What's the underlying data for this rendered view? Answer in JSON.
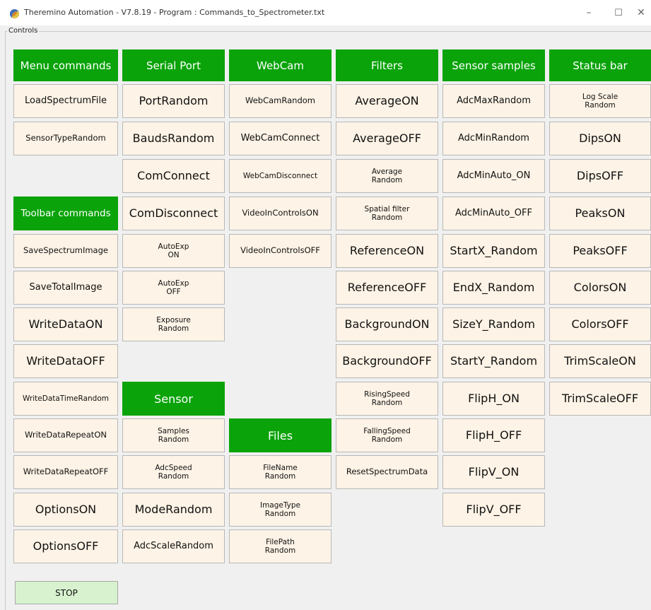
{
  "window": {
    "title": "Theremino Automation - V7.8.19  -  Program :  Commands_to_Spectrometer.txt",
    "minimize": "–",
    "maximize": "☐",
    "close": "✕"
  },
  "group_label": "Controls",
  "headers": {
    "menu": "Menu commands",
    "serial": "Serial Port",
    "webcam": "WebCam",
    "filters": "Filters",
    "samples": "Sensor samples",
    "status": "Status bar",
    "toolbar": "Toolbar commands",
    "sensor": "Sensor",
    "files": "Files"
  },
  "menu_commands": [
    "LoadSpectrumFile",
    "SensorTypeRandom"
  ],
  "toolbar_commands": [
    "SaveSpectrumImage",
    "SaveTotalImage",
    "WriteDataON",
    "WriteDataOFF",
    "WriteDataTimeRandom",
    "WriteDataRepeatON",
    "WriteDataRepeatOFF",
    "OptionsON",
    "OptionsOFF"
  ],
  "serial_port": [
    "PortRandom",
    "BaudsRandom",
    "ComConnect",
    "ComDisconnect",
    "AutoExp\nON",
    "AutoExp\nOFF",
    "Exposure\nRandom"
  ],
  "sensor": [
    "Samples\nRandom",
    "AdcSpeed\nRandom",
    "ModeRandom",
    "AdcScaleRandom"
  ],
  "webcam": [
    "WebCamRandom",
    "WebCamConnect",
    "WebCamDisconnect",
    "VideoInControlsON",
    "VideoInControlsOFF"
  ],
  "files": [
    "FileName\nRandom",
    "ImageType\nRandom",
    "FilePath\nRandom"
  ],
  "filters": [
    "AverageON",
    "AverageOFF",
    "Average\nRandom",
    "Spatial filter\nRandom",
    "ReferenceON",
    "ReferenceOFF",
    "BackgroundON",
    "BackgroundOFF",
    "RisingSpeed\nRandom",
    "FallingSpeed\nRandom",
    "ResetSpectrumData"
  ],
  "sensor_samples": [
    "AdcMaxRandom",
    "AdcMinRandom",
    "AdcMinAuto_ON",
    "AdcMinAuto_OFF",
    "StartX_Random",
    "EndX_Random",
    "SizeY_Random",
    "StartY_Random",
    "FlipH_ON",
    "FlipH_OFF",
    "FlipV_ON",
    "FlipV_OFF"
  ],
  "status_bar": [
    "Log Scale\nRandom",
    "DipsON",
    "DipsOFF",
    "PeaksON",
    "PeaksOFF",
    "ColorsON",
    "ColorsOFF",
    "TrimScaleON",
    "TrimScaleOFF"
  ],
  "stop_label": "STOP",
  "colors": {
    "header_green": "#0aa30a",
    "button_bg": "#fdf3e6",
    "stop_bg": "#d8f2cf"
  }
}
